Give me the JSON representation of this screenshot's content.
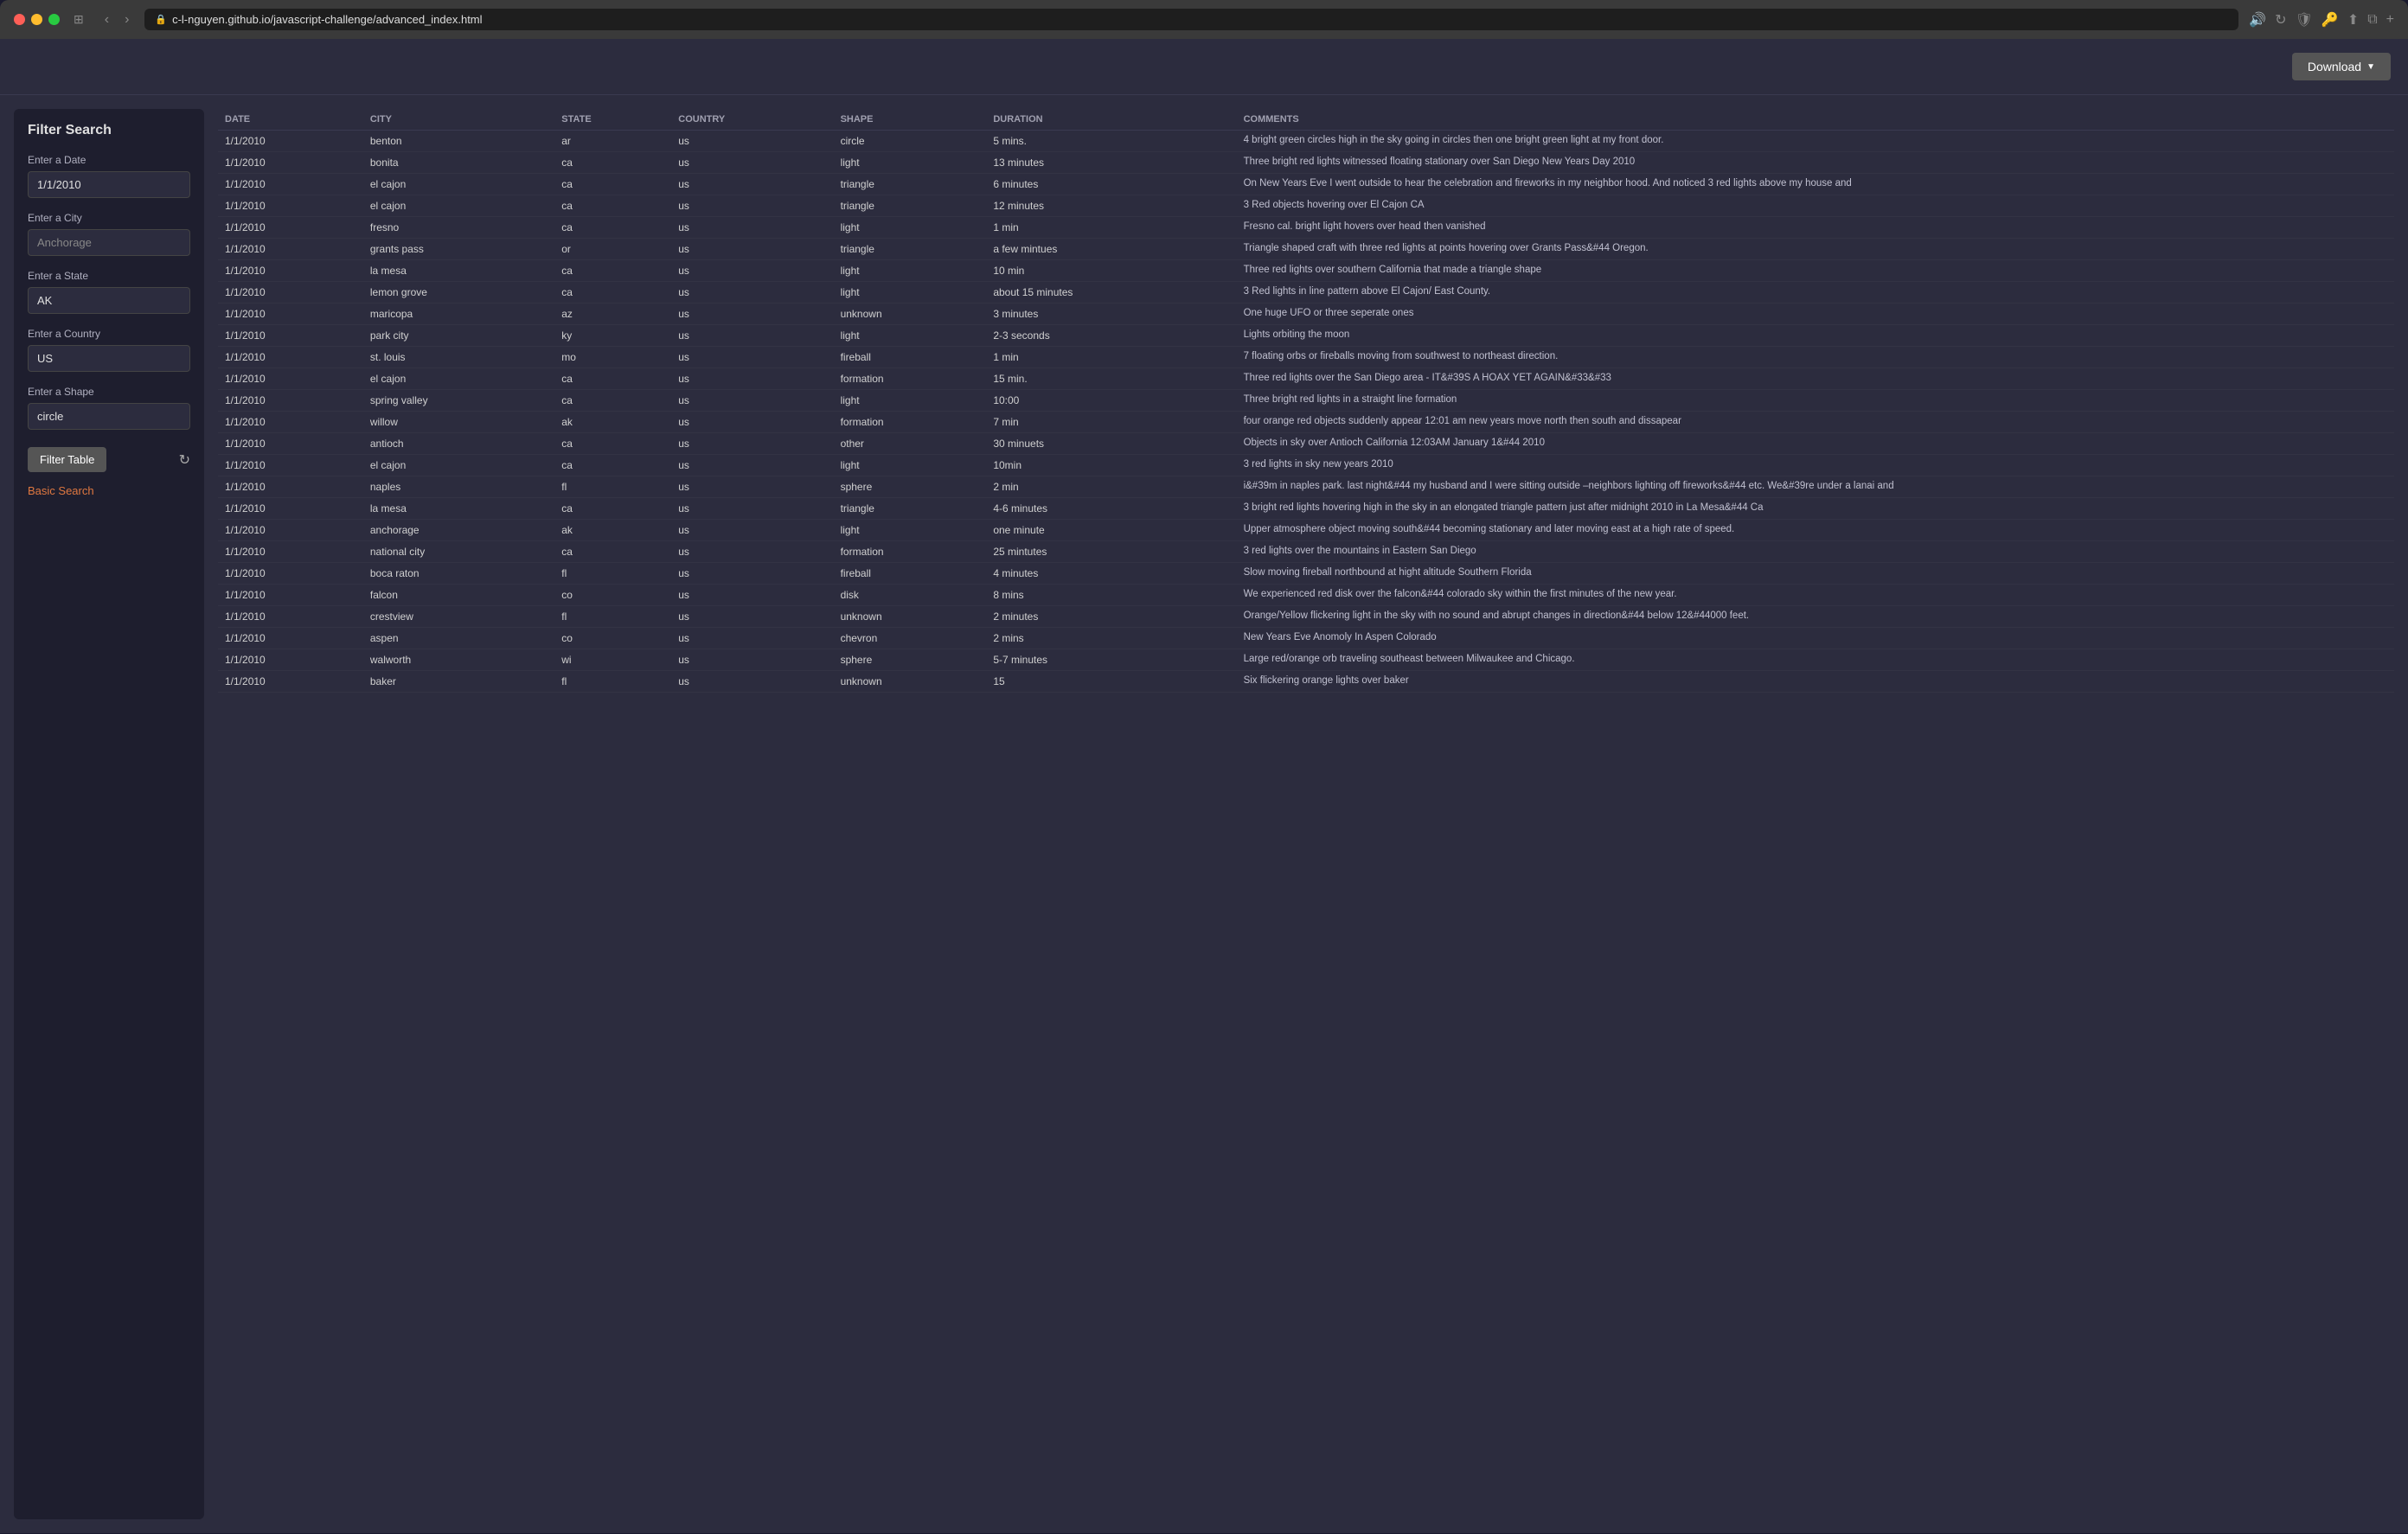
{
  "browser": {
    "url": "c-l-nguyen.github.io/javascript-challenge/advanced_index.html",
    "nav_back": "‹",
    "nav_forward": "›"
  },
  "header": {
    "download_label": "Download",
    "download_caret": "▼"
  },
  "filter": {
    "title": "Filter Search",
    "date_label": "Enter a Date",
    "date_placeholder": "1/1/2010",
    "date_value": "1/1/2010",
    "city_label": "Enter a City",
    "city_placeholder": "Anchorage",
    "state_label": "Enter a State",
    "state_value": "AK",
    "country_label": "Enter a Country",
    "country_value": "US",
    "shape_label": "Enter a Shape",
    "shape_value": "circle",
    "filter_btn": "Filter Table",
    "basic_search": "Basic Search"
  },
  "table": {
    "columns": [
      "DATE",
      "CITY",
      "STATE",
      "COUNTRY",
      "SHAPE",
      "DURATION",
      "COMMENTS"
    ],
    "rows": [
      {
        "date": "1/1/2010",
        "city": "benton",
        "state": "ar",
        "country": "us",
        "shape": "circle",
        "duration": "5 mins.",
        "comments": "4 bright green circles high in the sky going in circles then one bright green light at my front door."
      },
      {
        "date": "1/1/2010",
        "city": "bonita",
        "state": "ca",
        "country": "us",
        "shape": "light",
        "duration": "13 minutes",
        "comments": "Three bright red lights witnessed floating stationary over San Diego New Years Day 2010"
      },
      {
        "date": "1/1/2010",
        "city": "el cajon",
        "state": "ca",
        "country": "us",
        "shape": "triangle",
        "duration": "6 minutes",
        "comments": "On New Years Eve I went outside to hear the celebration and fireworks in my neighbor hood. And noticed 3 red lights above my house and"
      },
      {
        "date": "1/1/2010",
        "city": "el cajon",
        "state": "ca",
        "country": "us",
        "shape": "triangle",
        "duration": "12 minutes",
        "comments": "3 Red objects hovering over El Cajon CA"
      },
      {
        "date": "1/1/2010",
        "city": "fresno",
        "state": "ca",
        "country": "us",
        "shape": "light",
        "duration": "1 min",
        "comments": "Fresno cal. bright light hovers over head then vanished"
      },
      {
        "date": "1/1/2010",
        "city": "grants pass",
        "state": "or",
        "country": "us",
        "shape": "triangle",
        "duration": "a few mintues",
        "comments": "Triangle shaped craft with three red lights at points hovering over Grants Pass&#44 Oregon."
      },
      {
        "date": "1/1/2010",
        "city": "la mesa",
        "state": "ca",
        "country": "us",
        "shape": "light",
        "duration": "10 min",
        "comments": "Three red lights over southern California that made a triangle shape"
      },
      {
        "date": "1/1/2010",
        "city": "lemon grove",
        "state": "ca",
        "country": "us",
        "shape": "light",
        "duration": "about 15 minutes",
        "comments": "3 Red lights in line pattern above El Cajon/ East County."
      },
      {
        "date": "1/1/2010",
        "city": "maricopa",
        "state": "az",
        "country": "us",
        "shape": "unknown",
        "duration": "3 minutes",
        "comments": "One huge UFO or three seperate ones"
      },
      {
        "date": "1/1/2010",
        "city": "park city",
        "state": "ky",
        "country": "us",
        "shape": "light",
        "duration": "2-3 seconds",
        "comments": "Lights orbiting the moon"
      },
      {
        "date": "1/1/2010",
        "city": "st. louis",
        "state": "mo",
        "country": "us",
        "shape": "fireball",
        "duration": "1 min",
        "comments": "7 floating orbs or fireballs moving from southwest to northeast direction."
      },
      {
        "date": "1/1/2010",
        "city": "el cajon",
        "state": "ca",
        "country": "us",
        "shape": "formation",
        "duration": "15 min.",
        "comments": "Three red lights over the San Diego area - IT&#39S A HOAX YET AGAIN&#33&#33"
      },
      {
        "date": "1/1/2010",
        "city": "spring valley",
        "state": "ca",
        "country": "us",
        "shape": "light",
        "duration": "10:00",
        "comments": "Three bright red lights in a straight line formation"
      },
      {
        "date": "1/1/2010",
        "city": "willow",
        "state": "ak",
        "country": "us",
        "shape": "formation",
        "duration": "7 min",
        "comments": "four orange red objects suddenly appear 12:01 am new years move north then south and dissapear"
      },
      {
        "date": "1/1/2010",
        "city": "antioch",
        "state": "ca",
        "country": "us",
        "shape": "other",
        "duration": "30 minuets",
        "comments": "Objects in sky over Antioch California 12:03AM January 1&#44 2010"
      },
      {
        "date": "1/1/2010",
        "city": "el cajon",
        "state": "ca",
        "country": "us",
        "shape": "light",
        "duration": "10min",
        "comments": "3 red lights in sky new years 2010"
      },
      {
        "date": "1/1/2010",
        "city": "naples",
        "state": "fl",
        "country": "us",
        "shape": "sphere",
        "duration": "2 min",
        "comments": "i&#39m in naples park. last night&#44 my husband and I were sitting outside –neighbors lighting off fireworks&#44 etc. We&#39re under a lanai and"
      },
      {
        "date": "1/1/2010",
        "city": "la mesa",
        "state": "ca",
        "country": "us",
        "shape": "triangle",
        "duration": "4-6 minutes",
        "comments": "3 bright red lights hovering high in the sky in an elongated triangle pattern just after midnight 2010 in La Mesa&#44 Ca"
      },
      {
        "date": "1/1/2010",
        "city": "anchorage",
        "state": "ak",
        "country": "us",
        "shape": "light",
        "duration": "one minute",
        "comments": "Upper atmosphere object moving south&#44 becoming stationary and later moving east at a high rate of speed."
      },
      {
        "date": "1/1/2010",
        "city": "national city",
        "state": "ca",
        "country": "us",
        "shape": "formation",
        "duration": "25 mintutes",
        "comments": "3 red lights over the mountains in Eastern San Diego"
      },
      {
        "date": "1/1/2010",
        "city": "boca raton",
        "state": "fl",
        "country": "us",
        "shape": "fireball",
        "duration": "4 minutes",
        "comments": "Slow moving fireball northbound at hight altitude Southern Florida"
      },
      {
        "date": "1/1/2010",
        "city": "falcon",
        "state": "co",
        "country": "us",
        "shape": "disk",
        "duration": "8 mins",
        "comments": "We experienced red disk over the falcon&#44 colorado sky within the first minutes of the new year."
      },
      {
        "date": "1/1/2010",
        "city": "crestview",
        "state": "fl",
        "country": "us",
        "shape": "unknown",
        "duration": "2 minutes",
        "comments": "Orange/Yellow flickering light in the sky with no sound and abrupt changes in direction&#44 below 12&#44000 feet."
      },
      {
        "date": "1/1/2010",
        "city": "aspen",
        "state": "co",
        "country": "us",
        "shape": "chevron",
        "duration": "2 mins",
        "comments": "New Years Eve Anomoly In Aspen Colorado"
      },
      {
        "date": "1/1/2010",
        "city": "walworth",
        "state": "wi",
        "country": "us",
        "shape": "sphere",
        "duration": "5-7 minutes",
        "comments": "Large red/orange orb traveling southeast between Milwaukee and Chicago."
      },
      {
        "date": "1/1/2010",
        "city": "baker",
        "state": "fl",
        "country": "us",
        "shape": "unknown",
        "duration": "15",
        "comments": "Six flickering orange lights over baker"
      }
    ]
  }
}
